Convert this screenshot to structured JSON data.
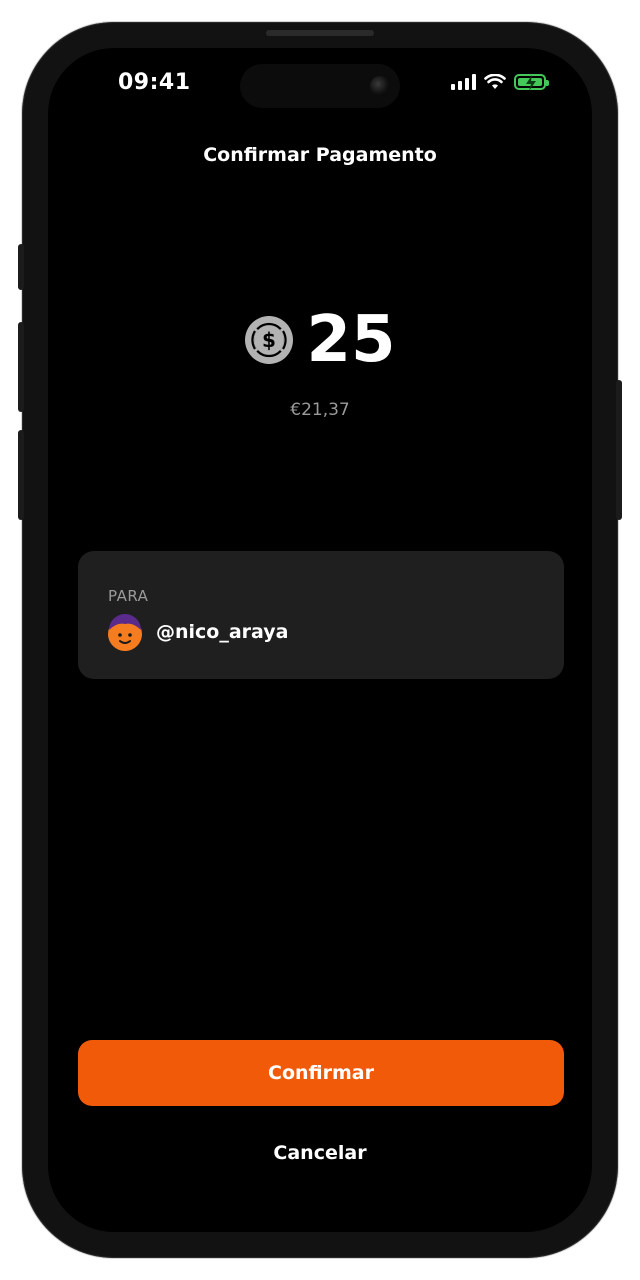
{
  "status_bar": {
    "time": "09:41",
    "icons": [
      "signal-icon",
      "wifi-icon",
      "battery-charging-icon"
    ]
  },
  "header": {
    "title": "Confirmar Pagamento"
  },
  "payment": {
    "currency_icon": "usd-coin-icon",
    "amount": "25",
    "fiat_equivalent": "€21,37"
  },
  "recipient": {
    "label": "PARA",
    "avatar_icon": "avatar-icon",
    "handle": "@nico_araya"
  },
  "actions": {
    "confirm_label": "Confirmar",
    "cancel_label": "Cancelar"
  },
  "colors": {
    "accent": "#f15a09",
    "background": "#000000",
    "card": "#1f1f20",
    "muted_text": "#9a9a9a",
    "battery": "#45c85a"
  }
}
